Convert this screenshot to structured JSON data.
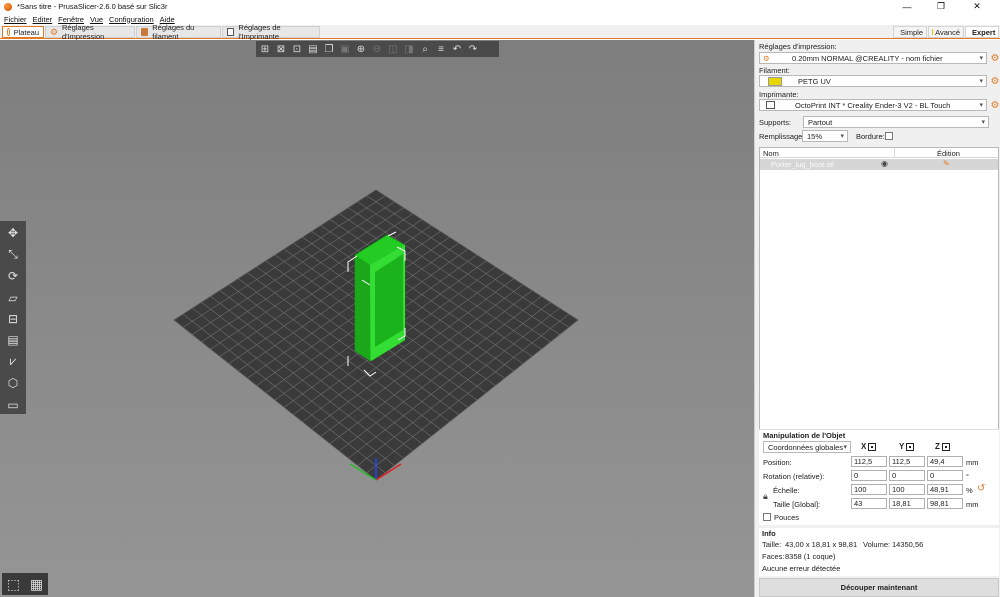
{
  "window": {
    "title": "*Sans titre - PrusaSlicer-2.6.0 basé sur Slic3r",
    "controls": {
      "minimize": "—",
      "restore": "❐",
      "close": "✕"
    }
  },
  "menu": [
    "Fichier",
    "Editer",
    "Fenêtre",
    "Vue",
    "Configuration",
    "Aide"
  ],
  "tabs": [
    {
      "label": "Plateau",
      "icon": "plater-icon",
      "active": true
    },
    {
      "label": "Réglages d'Impression",
      "icon": "cog-icon"
    },
    {
      "label": "Réglages du filament",
      "icon": "spool-icon"
    },
    {
      "label": "Réglages de l'Imprimante",
      "icon": "printer-icon"
    }
  ],
  "modes": [
    {
      "label": "Simple",
      "color": "#4caf50"
    },
    {
      "label": "Avancé",
      "color": "#e6c800"
    },
    {
      "label": "Expert",
      "color": "#e02020",
      "selected": true
    }
  ],
  "viewport": {
    "bed_color": "#3a3a3a",
    "grid_color": "#6e6e6e",
    "object_color": "#22cc22"
  },
  "sidebar": {
    "print_settings_label": "Réglages d'impression:",
    "print_settings_value": "0.20mm NORMAL @CREALITY - nom fichier",
    "filament_label": "Filament:",
    "filament_value": "PETG UV",
    "filament_color": "#e6d800",
    "printer_label": "Imprimante:",
    "printer_value": "OctoPrint INT * Creality Ender-3 V2 - BL Touch",
    "supports_label": "Supports:",
    "supports_value": "Partout",
    "infill_label": "Remplissage:",
    "infill_value": "15%",
    "brim_label": "Bordure:"
  },
  "object_list": {
    "col_name": "Nom",
    "col_edit": "Édition",
    "rows": [
      {
        "name": "Porter_lug_boot.stl"
      }
    ]
  },
  "manipulation": {
    "title": "Manipulation de l'Objet",
    "coord_select": "Coordonnées globales",
    "axes": [
      "X",
      "Y",
      "Z"
    ],
    "rows": [
      {
        "label": "Position:",
        "values": [
          "112,5",
          "112,5",
          "49,4"
        ],
        "unit": "mm"
      },
      {
        "label": "Rotation (relative):",
        "values": [
          "0",
          "0",
          "0"
        ],
        "unit": "°"
      },
      {
        "label": "Échelle:",
        "values": [
          "100",
          "100",
          "48,91"
        ],
        "unit": "%"
      },
      {
        "label": "Taille [Global]:",
        "values": [
          "43",
          "18,81",
          "98,81"
        ],
        "unit": "mm"
      }
    ],
    "inches_label": "Pouces"
  },
  "info": {
    "title": "Info",
    "size_label": "Taille:",
    "size_value": "43,00 x 18,81 x 98,81",
    "volume_label": "Volume:",
    "volume_value": "14350,56",
    "faces_label": "Faces:",
    "faces_value": "8358 (1 coque)",
    "errors": "Aucune erreur détectée"
  },
  "slice_button": "Découper maintenant"
}
